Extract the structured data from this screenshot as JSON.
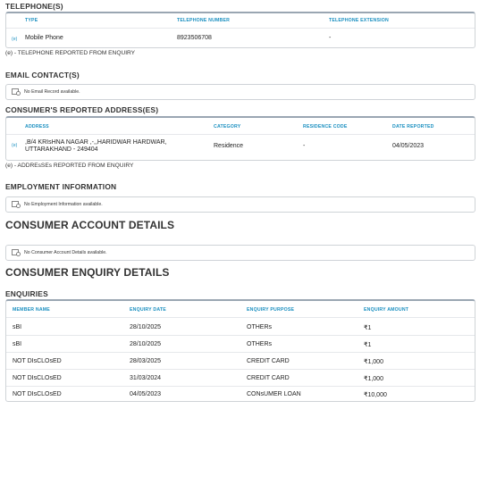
{
  "telephones": {
    "title": "TELEPHONE(S)",
    "headers": [
      "TYPE",
      "TELEPHONE NUMBER",
      "TELEPHONE EXTENSION"
    ],
    "rows": [
      {
        "tag": "(e)",
        "type": "Mobile Phone",
        "number": "8923506708",
        "extension": "-"
      }
    ],
    "note": "(e) - TELEPHONE REPORTED FROM ENQUIRY"
  },
  "email": {
    "title": "EMAIL CONTACT(S)",
    "empty_text": "No Email Record available."
  },
  "addresses": {
    "title": "CONSUMER'S REPORTED ADDRESS(ES)",
    "headers": [
      "ADDRESS",
      "CATEGORY",
      "RESIDENCE CODE",
      "DATE REPORTED"
    ],
    "rows": [
      {
        "tag": "(e)",
        "address_line1": ",B/4 KRIsHNA NAGAR ,-,,HARIDWAR HARDWAR,",
        "address_line2": "UTTARAKHAND - 249404",
        "category": "Residence",
        "residence_code": "-",
        "date": "04/05/2023"
      }
    ],
    "note": "(e) - ADDREsSEs REPORTED FROM ENQUIRY"
  },
  "employment": {
    "title": "EMPLOYMENT INFORMATION",
    "empty_text": "No Employment Information available."
  },
  "accounts": {
    "title": "CONSUMER ACCOUNT DETAILS",
    "empty_text": "No Consumer Account Details available."
  },
  "enquiry_details": {
    "title": "CONSUMER ENQUIRY DETAILS",
    "subtitle": "ENQUIRIES",
    "headers": [
      "MEMBER NAME",
      "ENQUIRY DATE",
      "ENQUIRY PURPOSE",
      "ENQUIRY AMOUNT"
    ],
    "rows": [
      {
        "member": "sBI",
        "date": "28/10/2025",
        "purpose": "OTHERs",
        "amount": "₹1"
      },
      {
        "member": "sBI",
        "date": "28/10/2025",
        "purpose": "OTHERs",
        "amount": "₹1"
      },
      {
        "member": "NOT DIsCLOsED",
        "date": "28/03/2025",
        "purpose": "CREDIT CARD",
        "amount": "₹1,000"
      },
      {
        "member": "NOT DIsCLOsED",
        "date": "31/03/2024",
        "purpose": "CREDIT CARD",
        "amount": "₹1,000"
      },
      {
        "member": "NOT DIsCLOsED",
        "date": "04/05/2023",
        "purpose": "CONsUMER LOAN",
        "amount": "₹10,000"
      }
    ]
  },
  "colors": {
    "accent": "#1a8fc0",
    "border": "#cfd3d7",
    "text": "#222222"
  }
}
